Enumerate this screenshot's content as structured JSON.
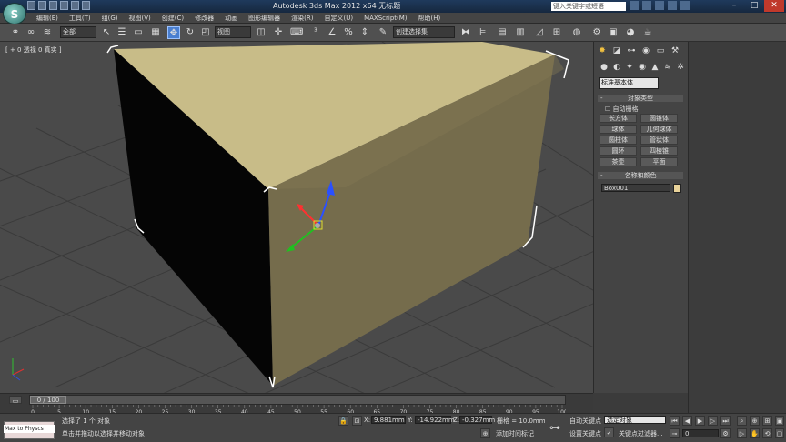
{
  "window": {
    "title": "Autodesk 3ds Max  2012 x64     无标题",
    "search_placeholder": "键入关键字或短语"
  },
  "menu": [
    "编辑(E)",
    "工具(T)",
    "组(G)",
    "视图(V)",
    "创建(C)",
    "修改器",
    "动画",
    "图形编辑器",
    "渲染(R)",
    "自定义(U)",
    "MAXScript(M)",
    "帮助(H)"
  ],
  "toolbar": {
    "filter_select": "全部",
    "view_select": "视图",
    "selection_set": "创建选择集"
  },
  "viewport": {
    "label": "[ + 0 透视 0 真实 ]"
  },
  "command_panel": {
    "primitive_select": "标准基本体",
    "object_type_header": "对象类型",
    "autogrid_label": "自动栅格",
    "buttons": [
      "长方体",
      "圆锥体",
      "球体",
      "几何球体",
      "圆柱体",
      "管状体",
      "圆环",
      "四棱锥",
      "茶壶",
      "平面"
    ],
    "name_color_header": "名称和颜色",
    "object_name": "Box001",
    "object_color": "#e9d39a",
    "minus": "-"
  },
  "timeline": {
    "frame_readout": "0 / 100",
    "ticks": [
      "0",
      "5",
      "10",
      "15",
      "20",
      "25",
      "30",
      "35",
      "40",
      "45",
      "50",
      "55",
      "60",
      "65",
      "70",
      "75",
      "80",
      "85",
      "90",
      "95",
      "100"
    ]
  },
  "status": {
    "maxscript": "Max to Physcs",
    "selected": "选择了 1 个 对象",
    "prompt": "单击并拖动以选择并移动对象",
    "x": "9.881mm",
    "y": "-14.922mm",
    "z": "-0.327mm",
    "x_label": "X:",
    "y_label": "Y:",
    "z_label": "Z:",
    "grid": "栅格 = 10.0mm",
    "add_key": "添加时间标记",
    "auto_key": "自动关键点",
    "set_key": "设置关键点",
    "key_filters": "关键点过滤器...",
    "selected_object": "选定对象",
    "frame": "0"
  }
}
